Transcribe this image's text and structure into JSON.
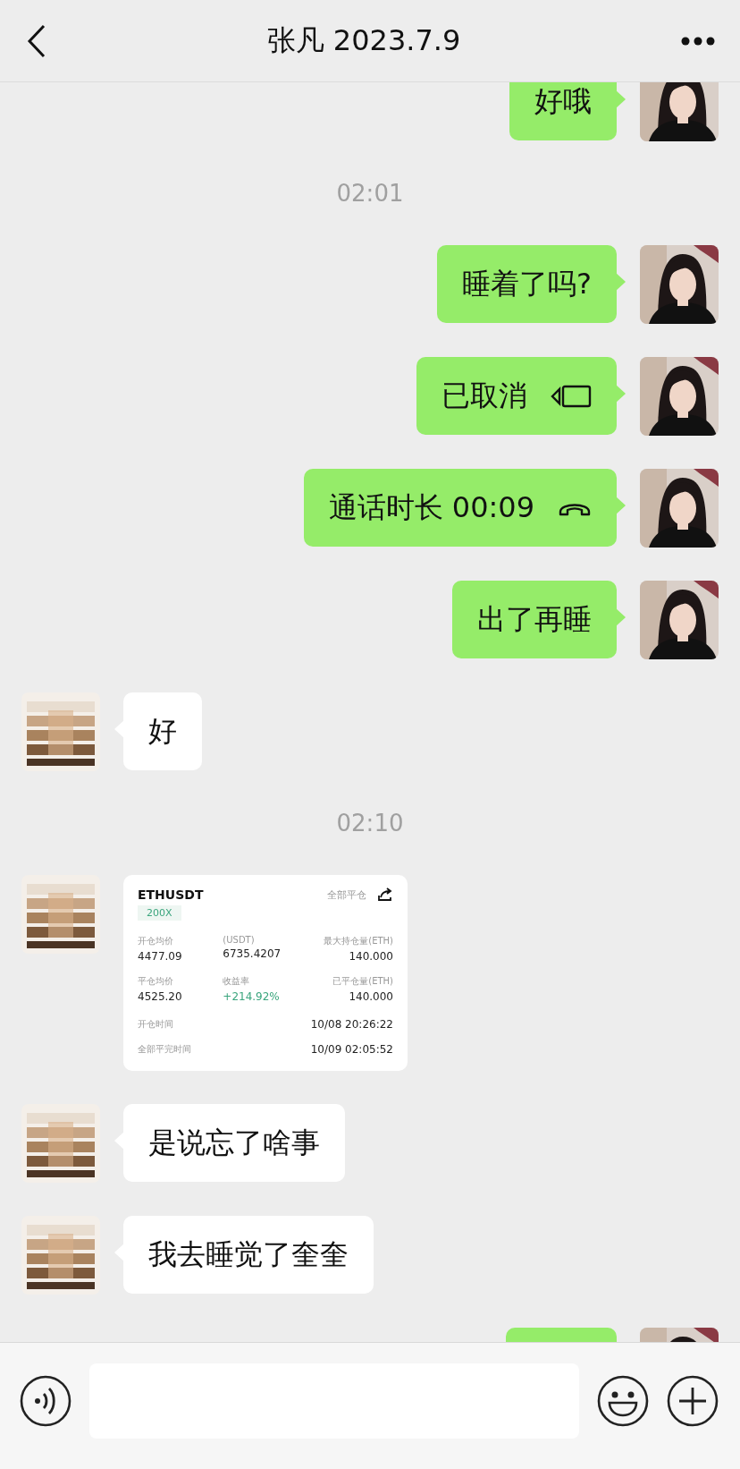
{
  "header": {
    "title": "张凡 2023.7.9"
  },
  "messages": [
    {
      "kind": "text",
      "outgoing": true,
      "text": "好哦"
    },
    {
      "kind": "time",
      "text": "02:01"
    },
    {
      "kind": "text",
      "outgoing": true,
      "text": "睡着了吗?"
    },
    {
      "kind": "video_call",
      "outgoing": true,
      "text": "已取消"
    },
    {
      "kind": "voice_call",
      "outgoing": true,
      "text": "通话时长 00:09"
    },
    {
      "kind": "text",
      "outgoing": true,
      "text": "出了再睡"
    },
    {
      "kind": "text",
      "outgoing": false,
      "text": "好"
    },
    {
      "kind": "time",
      "text": "02:10"
    },
    {
      "kind": "trade",
      "outgoing": false,
      "trade": {
        "symbol": "ETHUSDT",
        "leverage": "200X",
        "action": "全部平仓",
        "stats": [
          {
            "label": "开仓均价",
            "value": "4477.09",
            "positive": false
          },
          {
            "label": "(USDT)",
            "value": "6735.4207",
            "positive": false
          },
          {
            "label": "最大持仓量(ETH)",
            "value": "140.000",
            "positive": false
          },
          {
            "label": "平仓均价",
            "value": "4525.20",
            "positive": false
          },
          {
            "label": "收益率",
            "value": "+214.92%",
            "positive": true
          },
          {
            "label": "已平仓量(ETH)",
            "value": "140.000",
            "positive": false
          }
        ],
        "times": [
          {
            "label": "开仓时间",
            "value": "10/08 20:26:22"
          },
          {
            "label": "全部平完时间",
            "value": "10/09 02:05:52"
          }
        ]
      }
    },
    {
      "kind": "text",
      "outgoing": false,
      "text": "是说忘了啥事"
    },
    {
      "kind": "text",
      "outgoing": false,
      "text": "我去睡觉了奎奎"
    },
    {
      "kind": "cut",
      "outgoing": true
    }
  ]
}
